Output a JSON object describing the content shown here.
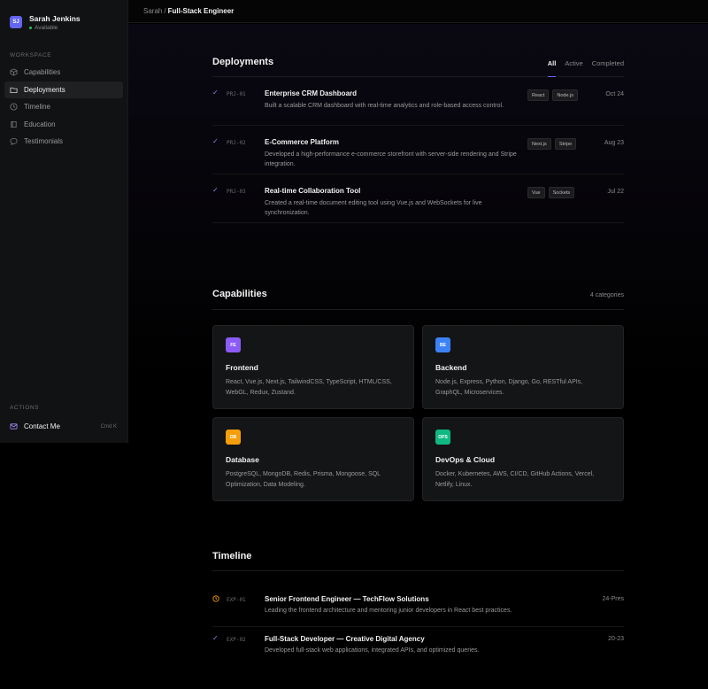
{
  "profile": {
    "initials": "SJ",
    "name": "Sarah Jenkins",
    "status": "Available"
  },
  "sidebar": {
    "workspace_label": "WORKSPACE",
    "items": [
      {
        "label": "Capabilities",
        "icon": "cube-icon"
      },
      {
        "label": "Deployments",
        "icon": "folder-icon"
      },
      {
        "label": "Timeline",
        "icon": "clock-icon"
      },
      {
        "label": "Education",
        "icon": "book-icon"
      },
      {
        "label": "Testimonials",
        "icon": "chat-icon"
      }
    ],
    "actions_label": "ACTIONS",
    "contact_label": "Contact Me",
    "contact_shortcut": "Cmd K"
  },
  "breadcrumb": {
    "parent": "Sarah",
    "separator": "/",
    "current": "Full-Stack Engineer"
  },
  "deployments": {
    "title": "Deployments",
    "tabs": [
      "All",
      "Active",
      "Completed"
    ],
    "rows": [
      {
        "code": "PRJ-01",
        "title": "Enterprise CRM Dashboard",
        "desc": "Built a scalable CRM dashboard with real-time analytics and role-based access control.",
        "tags": [
          "React",
          "Node.js"
        ],
        "date": "Oct 24"
      },
      {
        "code": "PRJ-02",
        "title": "E-Commerce Platform",
        "desc": "Developed a high-performance e-commerce storefront with server-side rendering and Stripe integration.",
        "tags": [
          "Next.js",
          "Stripe"
        ],
        "date": "Aug 23"
      },
      {
        "code": "PRJ-03",
        "title": "Real-time Collaboration Tool",
        "desc": "Created a real-time document editing tool using Vue.js and WebSockets for live synchronization.",
        "tags": [
          "Vue",
          "Sockets"
        ],
        "date": "Jul 22"
      }
    ]
  },
  "capabilities": {
    "title": "Capabilities",
    "count": "4 categories",
    "cards": [
      {
        "badge": "FE",
        "color": "#8b5cf6",
        "title": "Frontend",
        "desc": "React, Vue.js, Next.js, TailwindCSS, TypeScript, HTML/CSS, WebGL, Redux, Zustand."
      },
      {
        "badge": "BE",
        "color": "#3b82f6",
        "title": "Backend",
        "desc": "Node.js, Express, Python, Django, Go, RESTful APIs, GraphQL, Microservices."
      },
      {
        "badge": "DB",
        "color": "#f59e0b",
        "title": "Database",
        "desc": "PostgreSQL, MongoDB, Redis, Prisma, Mongoose, SQL Optimization, Data Modeling."
      },
      {
        "badge": "OPS",
        "color": "#10b981",
        "title": "DevOps & Cloud",
        "desc": "Docker, Kubernetes, AWS, CI/CD, GitHub Actions, Vercel, Netlify, Linux."
      }
    ]
  },
  "timeline": {
    "title": "Timeline",
    "rows": [
      {
        "code": "EXP-01",
        "title": "Senior Frontend Engineer — TechFlow Solutions",
        "desc": "Leading the frontend architecture and mentoring junior developers in React best practices.",
        "date": "24-Pres",
        "state": "current"
      },
      {
        "code": "EXP-02",
        "title": "Full-Stack Developer — Creative Digital Agency",
        "desc": "Developed full-stack web applications, integrated APIs, and optimized queries.",
        "date": "20-23",
        "state": "done"
      }
    ]
  },
  "colors": {
    "accent": "#6366f1",
    "check": "#818cf8",
    "current": "#f59e0b",
    "status": "#22c55e"
  }
}
